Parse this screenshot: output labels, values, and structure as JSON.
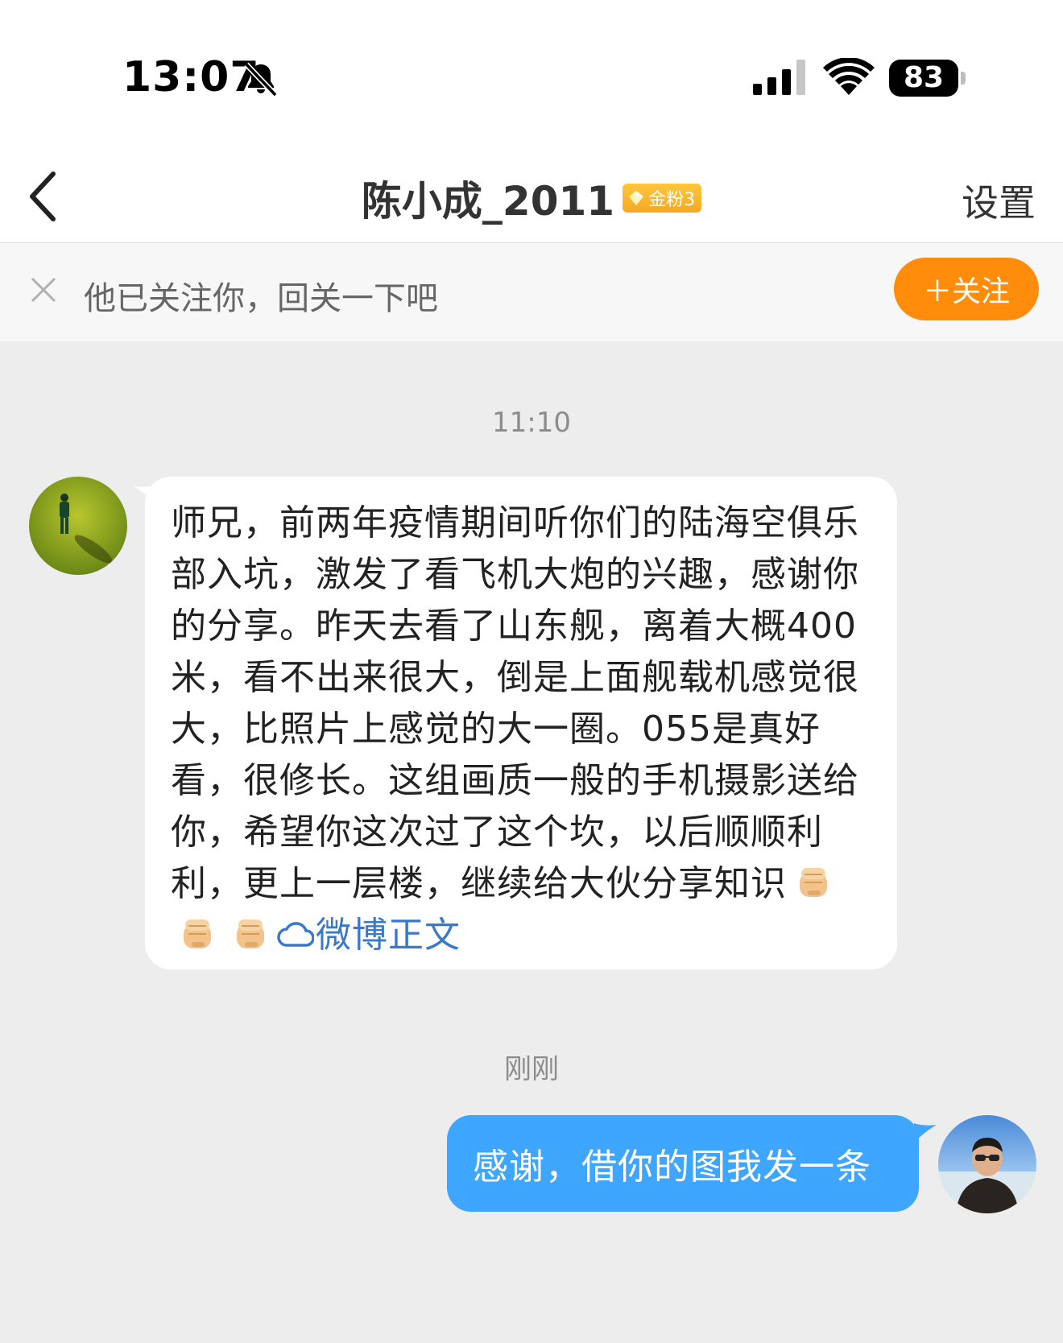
{
  "status_bar": {
    "time": "13:07",
    "battery": "83",
    "icons": [
      "bell-muted-icon",
      "signal-icon",
      "wifi-icon",
      "battery-icon"
    ]
  },
  "header": {
    "title": "陈小成_2011",
    "badge": "金粉3",
    "settings_label": "设置",
    "back_icon": "chevron-left-icon"
  },
  "follow_banner": {
    "text": "他已关注你，回关一下吧",
    "button_label": "＋关注",
    "button_color": "#ff8c0a"
  },
  "chat": {
    "messages": [
      {
        "time": "11:10",
        "direction": "incoming",
        "text": "师兄，前两年疫情期间听你们的陆海空俱乐部入坑，激发了看飞机大炮的兴趣，感谢你的分享。昨天去看了山东舰，离着大概400米，看不出来很大，倒是上面舰载机感觉很大，比照片上感觉的大一圈。055是真好看，很修长。这组画质一般的手机摄影送给你，希望你这次过了这个坎，以后顺顺利利，更上一层楼，继续给大伙分享知识",
        "emojis": [
          "fist-emoji",
          "fist-emoji",
          "fist-emoji"
        ],
        "link_label": "微博正文",
        "link_icon": "weibo-cloud-icon"
      },
      {
        "time": "刚刚",
        "direction": "outgoing",
        "text": "感谢，借你的图我发一条"
      }
    ],
    "bubble_out_color": "#3ea6ff",
    "link_color": "#3a78c9"
  }
}
